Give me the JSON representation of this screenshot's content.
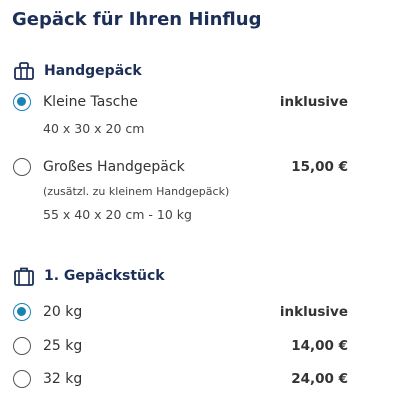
{
  "title": "Gepäck für Ihren Hinflug",
  "handgepaeck": {
    "heading": "Handgepäck",
    "icon": "hand-baggage-icon",
    "options": [
      {
        "label": "Kleine Tasche",
        "price": "inklusive",
        "dimensions": "40 x 30 x 20 cm",
        "selected": true
      },
      {
        "label": "Großes Handgepäck",
        "price": "15,00 €",
        "note": "(zusätzl. zu kleinem Handgepäck)",
        "dimensions": "55 x 40 x 20 cm - 10 kg",
        "selected": false
      }
    ]
  },
  "gepaeckstueck": {
    "heading": "1. Gepäckstück",
    "icon": "suitcase-icon",
    "options": [
      {
        "label": "20 kg",
        "price": "inklusive",
        "selected": true
      },
      {
        "label": "25 kg",
        "price": "14,00 €",
        "selected": false
      },
      {
        "label": "32 kg",
        "price": "24,00 €",
        "selected": false
      }
    ]
  },
  "colors": {
    "heading": "#1c2f56",
    "accent": "#1a82b4",
    "text": "#333333"
  }
}
